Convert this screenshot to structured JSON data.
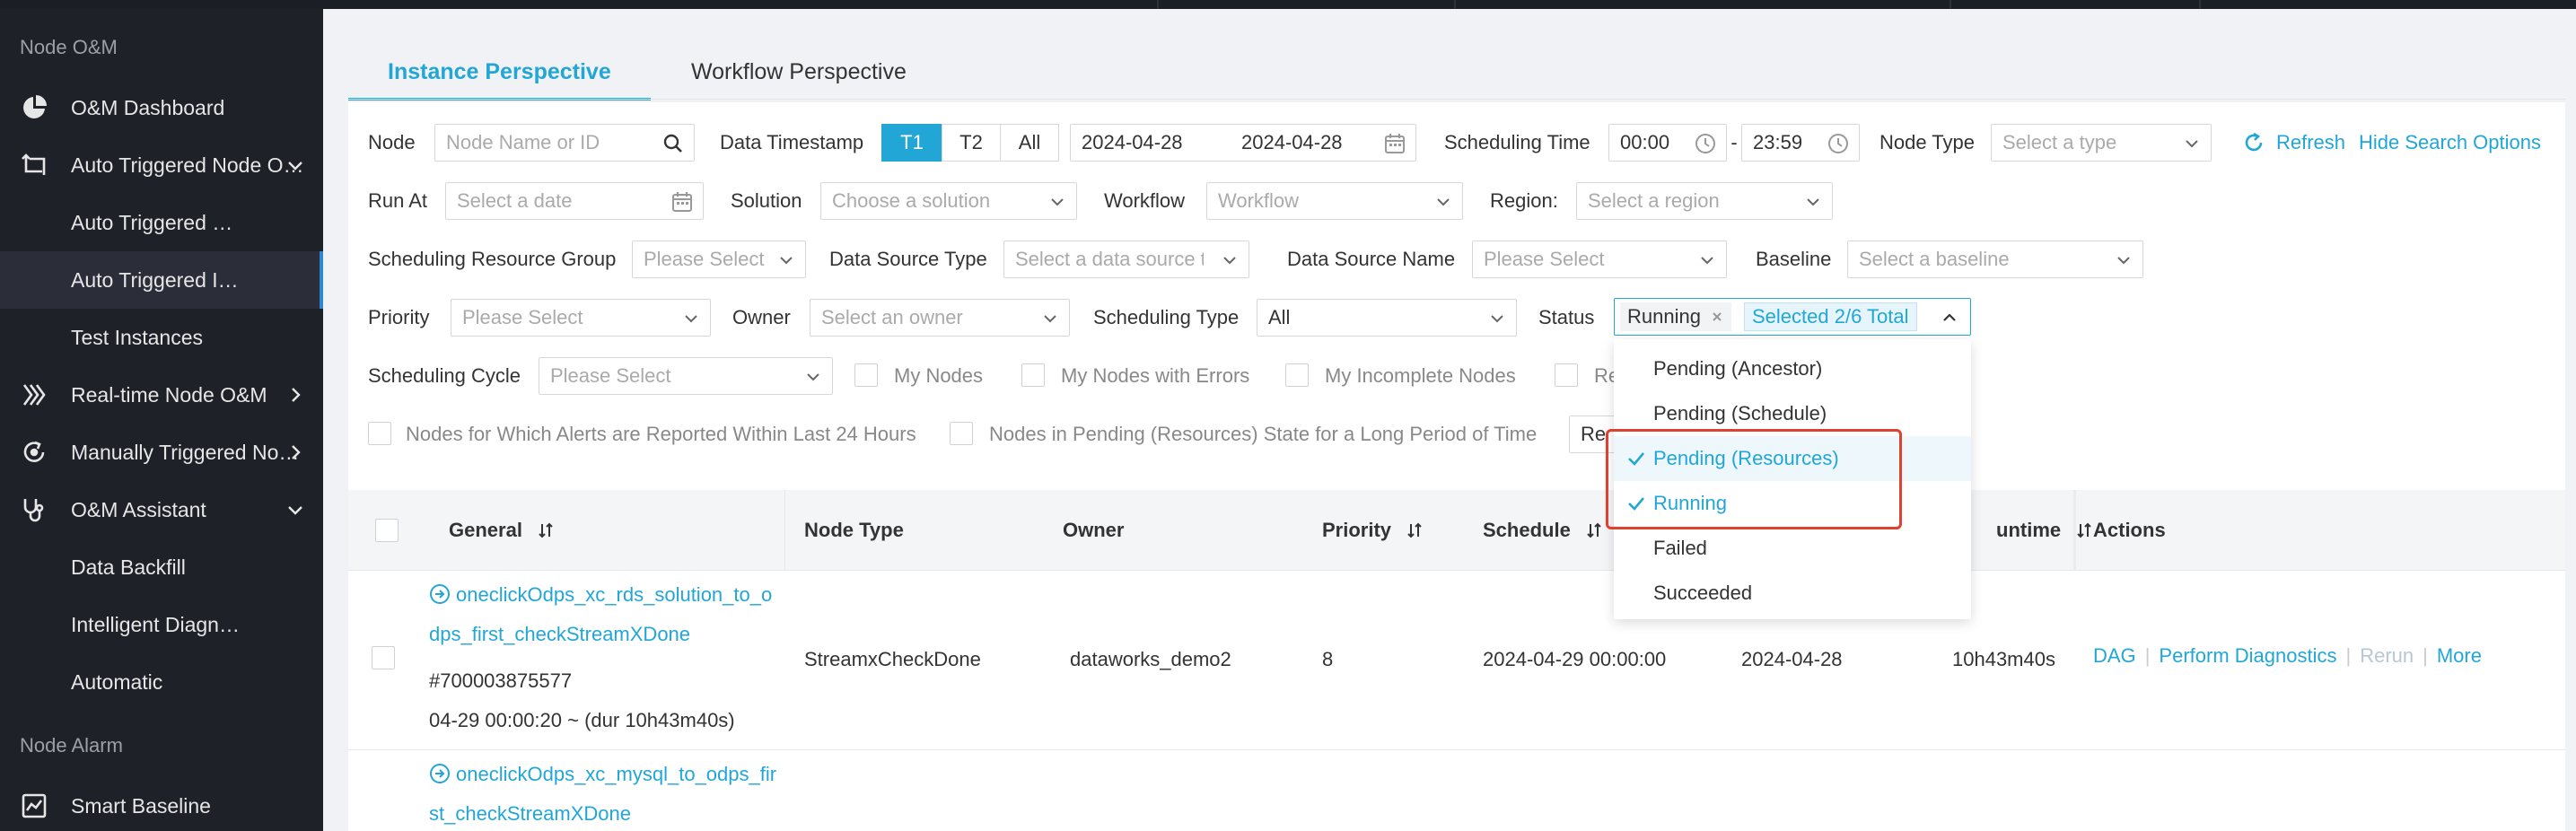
{
  "sidebar": {
    "group_node_om": "Node O&M",
    "group_node_alarm": "Node Alarm",
    "items": [
      {
        "label": "O&M Dashboard"
      },
      {
        "label": "Auto Triggered Node O…"
      },
      {
        "label": "Auto Triggered …"
      },
      {
        "label": "Auto Triggered I…"
      },
      {
        "label": "Test Instances"
      },
      {
        "label": "Real-time Node O&M"
      },
      {
        "label": "Manually Triggered No…"
      },
      {
        "label": "O&M Assistant"
      },
      {
        "label": "Data Backfill"
      },
      {
        "label": "Intelligent Diagn…"
      },
      {
        "label": "Automatic"
      },
      {
        "label": "Smart Baseline"
      }
    ]
  },
  "tabs": [
    {
      "label": "Instance Perspective"
    },
    {
      "label": "Workflow Perspective"
    }
  ],
  "filters": {
    "node_label": "Node",
    "node_placeholder": "Node Name or ID",
    "data_timestamp_label": "Data Timestamp",
    "t1": "T1",
    "t2": "T2",
    "all": "All",
    "date_start": "2024-04-28",
    "date_end": "2024-04-28",
    "scheduling_time_label": "Scheduling Time",
    "time_start": "00:00",
    "time_dash": "-",
    "time_end": "23:59",
    "node_type_label": "Node Type",
    "node_type_placeholder": "Select a type",
    "refresh": "Refresh",
    "hide_search": "Hide Search Options",
    "run_at_label": "Run At",
    "run_at_placeholder": "Select a date",
    "solution_label": "Solution",
    "solution_placeholder": "Choose a solution",
    "workflow_label": "Workflow",
    "workflow_placeholder": "Workflow",
    "region_label": "Region:",
    "region_placeholder": "Select a region",
    "srg_label": "Scheduling Resource Group",
    "please_select": "Please Select",
    "dst_label": "Data Source Type",
    "dst_placeholder": "Select a data source typ",
    "dsn_label": "Data Source Name",
    "baseline_label": "Baseline",
    "baseline_placeholder": "Select a baseline",
    "priority_label": "Priority",
    "owner_label": "Owner",
    "owner_placeholder": "Select an owner",
    "sched_type_label": "Scheduling Type",
    "sched_type_value": "All",
    "status_label": "Status",
    "status_tag": "Running",
    "status_count": "Selected 2/6 Total",
    "sched_cycle_label": "Scheduling Cycle",
    "my_nodes": "My Nodes",
    "my_nodes_errors": "My Nodes with Errors",
    "my_incomplete": "My Incomplete Nodes",
    "re_partial": "Re",
    "alerts_24h": "Nodes for Which Alerts are Reported Within Last 24 Hours",
    "pending_long": "Nodes in Pending (Resources) State for a Long Period of Time",
    "re_button_partial": "Re"
  },
  "table": {
    "headers": {
      "general": "General",
      "node_type": "Node Type",
      "owner": "Owner",
      "priority": "Priority",
      "schedule": "Schedule",
      "runtime": "untime",
      "actions": "Actions"
    },
    "rows": [
      {
        "name_line1": "oneclickOdps_xc_rds_solution_to_o",
        "name_line2": "dps_first_checkStreamXDone",
        "id": "#700003875577",
        "time": "04-29 00:00:20 ~ (dur 10h43m40s)",
        "node_type": "StreamxCheckDone",
        "owner": "dataworks_demo2",
        "priority": "8",
        "schedule": "2024-04-29 00:00:00",
        "data_ts": "2024-04-28",
        "runtime": "10h43m40s"
      },
      {
        "name_line1": "oneclickOdps_xc_mysql_to_odps_fir",
        "name_line2": "st_checkStreamXDone"
      }
    ],
    "actions": {
      "dag": "DAG",
      "diagnose": "Perform Diagnostics",
      "rerun": "Rerun",
      "more": "More",
      "sep": "|"
    }
  },
  "status_dropdown": {
    "options": [
      {
        "label": "Pending (Ancestor)",
        "selected": false
      },
      {
        "label": "Pending (Schedule)",
        "selected": false
      },
      {
        "label": "Pending (Resources)",
        "selected": true
      },
      {
        "label": "Running",
        "selected": true
      },
      {
        "label": "Failed",
        "selected": false
      },
      {
        "label": "Succeeded",
        "selected": false
      }
    ]
  },
  "colors": {
    "accent": "#22a6d6",
    "sidebar_bg": "#1f2129",
    "highlight_box": "#e0402f"
  }
}
